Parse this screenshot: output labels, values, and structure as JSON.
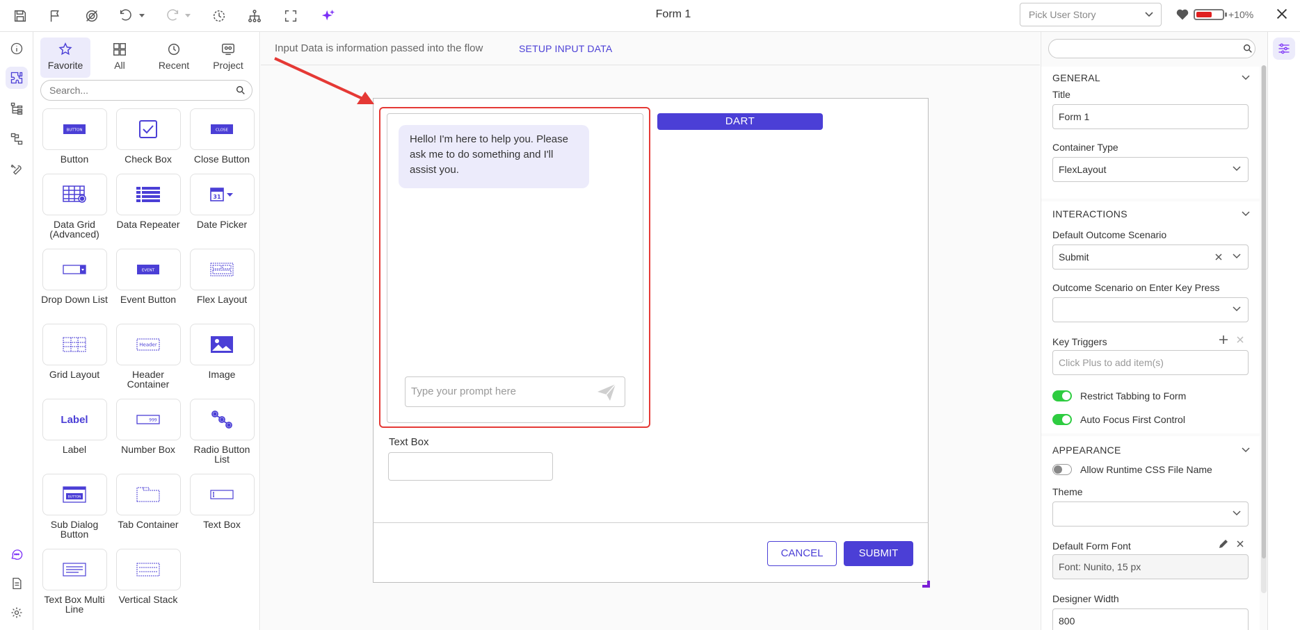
{
  "toolbar": {
    "title": "Form 1",
    "user_story_placeholder": "Pick User Story",
    "battery_percent": 60,
    "zoom_label": "+10%",
    "accent": "#4b3fd6"
  },
  "palette": {
    "tabs": [
      {
        "label": "Favorite",
        "active": true
      },
      {
        "label": "All"
      },
      {
        "label": "Recent"
      },
      {
        "label": "Project"
      }
    ],
    "search_placeholder": "Search...",
    "controls": [
      {
        "name": "Button",
        "icon": "button-icon",
        "preview": "BUTTON"
      },
      {
        "name": "Check Box",
        "icon": "checkbox-icon"
      },
      {
        "name": "Close Button",
        "icon": "close-button-icon",
        "preview": "CLOSE"
      },
      {
        "name": "Data Grid (Advanced)",
        "icon": "data-grid-icon"
      },
      {
        "name": "Data Repeater",
        "icon": "data-repeater-icon"
      },
      {
        "name": "Date Picker",
        "icon": "date-picker-icon",
        "preview": "31"
      },
      {
        "name": "Drop Down List",
        "icon": "dropdown-icon"
      },
      {
        "name": "Event Button",
        "icon": "event-button-icon",
        "preview": "EVENT"
      },
      {
        "name": "Flex Layout",
        "icon": "flex-layout-icon"
      },
      {
        "name": "Grid Layout",
        "icon": "grid-layout-icon"
      },
      {
        "name": "Header Container",
        "icon": "header-container-icon",
        "preview": "Header"
      },
      {
        "name": "Image",
        "icon": "image-icon"
      },
      {
        "name": "Label",
        "icon": "label-icon",
        "preview": "Label"
      },
      {
        "name": "Number Box",
        "icon": "number-box-icon",
        "preview": "999"
      },
      {
        "name": "Radio Button List",
        "icon": "radio-list-icon"
      },
      {
        "name": "Sub Dialog Button",
        "icon": "sub-dialog-icon",
        "preview": "BUTTON"
      },
      {
        "name": "Tab Container",
        "icon": "tab-container-icon"
      },
      {
        "name": "Text Box",
        "icon": "text-box-icon"
      },
      {
        "name": "Text Box Multi Line",
        "icon": "text-multiline-icon"
      },
      {
        "name": "Vertical Stack",
        "icon": "vertical-stack-icon"
      }
    ]
  },
  "canvas": {
    "input_data_text": "Input Data is information passed into the flow",
    "setup_link": "SETUP INPUT DATA",
    "chat_bubble": "Hello! I'm here to help you. Please ask me to do something and I'll assist you.",
    "prompt_placeholder": "Type your prompt here",
    "dart_label": "DART",
    "textbox_label": "Text Box",
    "cancel_label": "CANCEL",
    "submit_label": "SUBMIT",
    "highlight_color": "#e53935"
  },
  "properties": {
    "general": {
      "header": "GENERAL",
      "title_label": "Title",
      "title_value": "Form 1",
      "container_type_label": "Container Type",
      "container_type_value": "FlexLayout"
    },
    "interactions": {
      "header": "INTERACTIONS",
      "default_outcome_label": "Default Outcome Scenario",
      "default_outcome_value": "Submit",
      "enter_key_label": "Outcome Scenario on Enter Key Press",
      "enter_key_value": "",
      "key_triggers_label": "Key Triggers",
      "key_triggers_placeholder": "Click Plus to add item(s)",
      "restrict_tabbing_label": "Restrict Tabbing to Form",
      "restrict_tabbing_on": true,
      "auto_focus_label": "Auto Focus First Control",
      "auto_focus_on": true
    },
    "appearance": {
      "header": "APPEARANCE",
      "allow_css_label": "Allow Runtime CSS File Name",
      "allow_css_on": false,
      "theme_label": "Theme",
      "theme_value": "",
      "default_font_label": "Default Form Font",
      "default_font_value": "Font: Nunito, 15 px",
      "designer_width_label": "Designer Width",
      "designer_width_value": "800"
    }
  }
}
